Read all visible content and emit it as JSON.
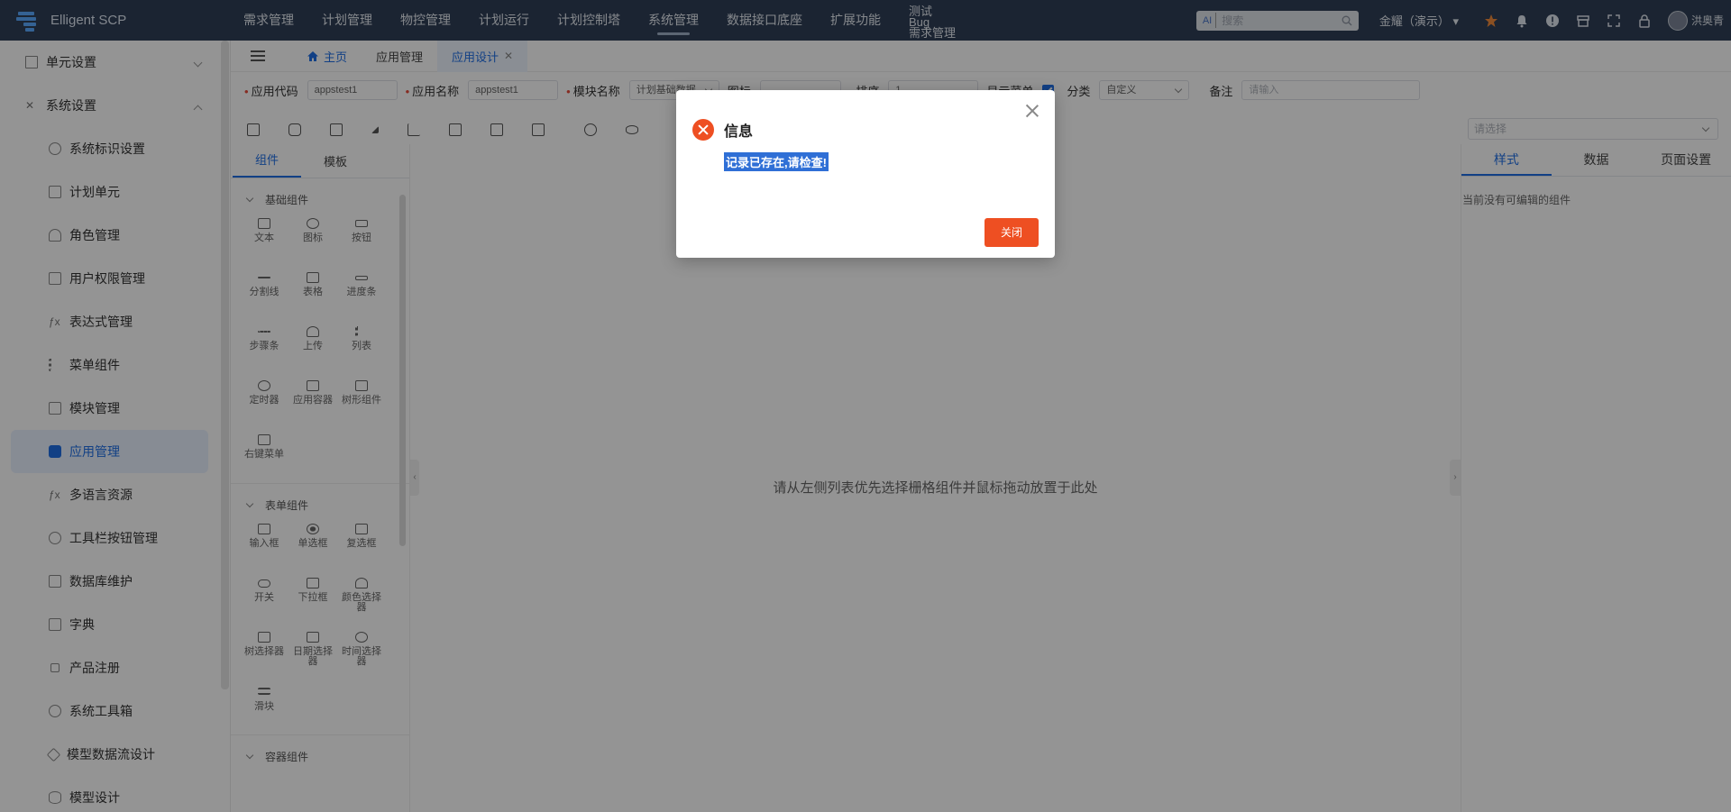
{
  "app": {
    "name": "Elligent SCP"
  },
  "nav": {
    "items": [
      "需求管理",
      "计划管理",
      "物控管理",
      "计划运行",
      "计划控制塔",
      "系统管理",
      "数据接口底座",
      "扩展功能"
    ],
    "active": "系统管理",
    "stack": [
      "测试",
      "Bug",
      "需求管理"
    ]
  },
  "topbar": {
    "search_prefix": "AI",
    "search_placeholder": "搜索",
    "org": "金耀（演示）",
    "user": "洪奥青"
  },
  "sidebar": {
    "group_unit": "单元设置",
    "group_system": "系统设置",
    "items": [
      "系统标识设置",
      "计划单元",
      "角色管理",
      "用户权限管理",
      "表达式管理",
      "菜单组件",
      "模块管理",
      "应用管理",
      "多语言资源",
      "工具栏按钮管理",
      "数据库维护",
      "字典",
      "产品注册",
      "系统工具箱",
      "模型数据流设计",
      "模型设计"
    ]
  },
  "tabs": {
    "home": "主页",
    "app_mgmt": "应用管理",
    "app_design": "应用设计"
  },
  "form": {
    "code_label": "应用代码",
    "code_value": "appstest1",
    "name_label": "应用名称",
    "name_value": "appstest1",
    "module_label": "模块名称",
    "module_value": "计划基础数据",
    "icon_label": "图标",
    "sort_label": "排序",
    "sort_value": "1",
    "show_menu_label": "显示菜单",
    "category_label": "分类",
    "category_value": "自定义",
    "note_label": "备注",
    "note_placeholder": "请输入"
  },
  "right_select": {
    "placeholder": "请选择"
  },
  "palette": {
    "tabs": [
      "组件",
      "模板"
    ],
    "basic_title": "基础组件",
    "basic": [
      "文本",
      "图标",
      "按钮",
      "分割线",
      "表格",
      "进度条",
      "步骤条",
      "上传",
      "列表",
      "定时器",
      "应用容器",
      "树形组件",
      "右键菜单"
    ],
    "form_title": "表单组件",
    "form": [
      "输入框",
      "单选框",
      "复选框",
      "开关",
      "下拉框",
      "颜色选择器",
      "树选择器",
      "日期选择器",
      "时间选择器",
      "滑块"
    ],
    "container_title": "容器组件"
  },
  "canvas": {
    "hint": "请从左侧列表优先选择栅格组件并鼠标拖动放置于此处"
  },
  "props": {
    "tabs": [
      "样式",
      "数据",
      "页面设置"
    ],
    "empty": "当前没有可编辑的组件"
  },
  "dialog": {
    "title": "信息",
    "message": "记录已存在,请检查!",
    "button": "关闭"
  },
  "colors": {
    "topbar": "#2f3e56",
    "accent": "#1f6fe5",
    "danger": "#ee4f22"
  }
}
